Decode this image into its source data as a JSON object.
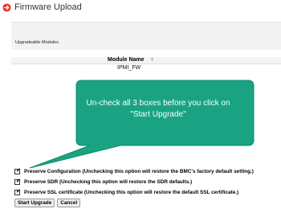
{
  "page": {
    "title": "Firmware Upload",
    "title_icon": "circle-arrow-icon",
    "accent_color": "#e8322f"
  },
  "modules": {
    "label": "Upgradeable Modules"
  },
  "table": {
    "columns": [
      "Module Name"
    ],
    "sort_indicator": "⇕",
    "rows": [
      [
        "IPMI_FW"
      ]
    ]
  },
  "callout": {
    "text": "Un-check all 3 boxes before you click on \"Start Upgrade\"",
    "color": "#1aa383"
  },
  "options": [
    {
      "label": "Preserve Configuration (Unchecking this option will restore the BMC's factory default setting.)",
      "checked": true
    },
    {
      "label": "Preserve SDR (Unchecking this option will restore the SDR defaults.)",
      "checked": true
    },
    {
      "label": "Preserve SSL certificate (Unchecking this option will restore the default SSL certificate.)",
      "checked": true
    }
  ],
  "buttons": {
    "start_label": "Start Upgrade",
    "cancel_label": "Cancel"
  }
}
